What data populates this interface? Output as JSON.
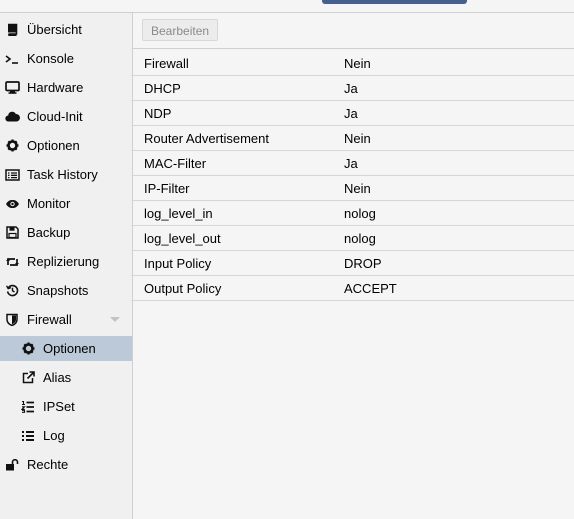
{
  "sidebar": {
    "items": [
      {
        "id": "uebersicht",
        "label": "Übersicht",
        "icon": "book-icon"
      },
      {
        "id": "konsole",
        "label": "Konsole",
        "icon": "terminal-icon"
      },
      {
        "id": "hardware",
        "label": "Hardware",
        "icon": "desktop-icon"
      },
      {
        "id": "cloudinit",
        "label": "Cloud-Init",
        "icon": "cloud-icon"
      },
      {
        "id": "optionen",
        "label": "Optionen",
        "icon": "gear-icon"
      },
      {
        "id": "taskhistory",
        "label": "Task History",
        "icon": "list-alt-icon"
      },
      {
        "id": "monitor",
        "label": "Monitor",
        "icon": "eye-icon"
      },
      {
        "id": "backup",
        "label": "Backup",
        "icon": "floppy-icon"
      },
      {
        "id": "replizierung",
        "label": "Replizierung",
        "icon": "retweet-icon"
      },
      {
        "id": "snapshots",
        "label": "Snapshots",
        "icon": "history-icon"
      },
      {
        "id": "firewall",
        "label": "Firewall",
        "icon": "shield-icon"
      },
      {
        "id": "fw-optionen",
        "label": "Optionen",
        "icon": "gear-icon"
      },
      {
        "id": "fw-alias",
        "label": "Alias",
        "icon": "external-link-icon"
      },
      {
        "id": "fw-ipset",
        "label": "IPSet",
        "icon": "list-ol-icon"
      },
      {
        "id": "fw-log",
        "label": "Log",
        "icon": "list-icon"
      },
      {
        "id": "rechte",
        "label": "Rechte",
        "icon": "unlock-icon"
      }
    ],
    "selected": "fw-optionen"
  },
  "toolbar": {
    "edit_label": "Bearbeiten"
  },
  "options": [
    {
      "key": "Firewall",
      "value": "Nein"
    },
    {
      "key": "DHCP",
      "value": "Ja"
    },
    {
      "key": "NDP",
      "value": "Ja"
    },
    {
      "key": "Router Advertisement",
      "value": "Nein"
    },
    {
      "key": "MAC-Filter",
      "value": "Ja"
    },
    {
      "key": "IP-Filter",
      "value": "Nein"
    },
    {
      "key": "log_level_in",
      "value": "nolog"
    },
    {
      "key": "log_level_out",
      "value": "nolog"
    },
    {
      "key": "Input Policy",
      "value": "DROP"
    },
    {
      "key": "Output Policy",
      "value": "ACCEPT"
    }
  ],
  "colors": {
    "selected_bg": "#bcc9d8",
    "top_button": "#475f8f"
  }
}
